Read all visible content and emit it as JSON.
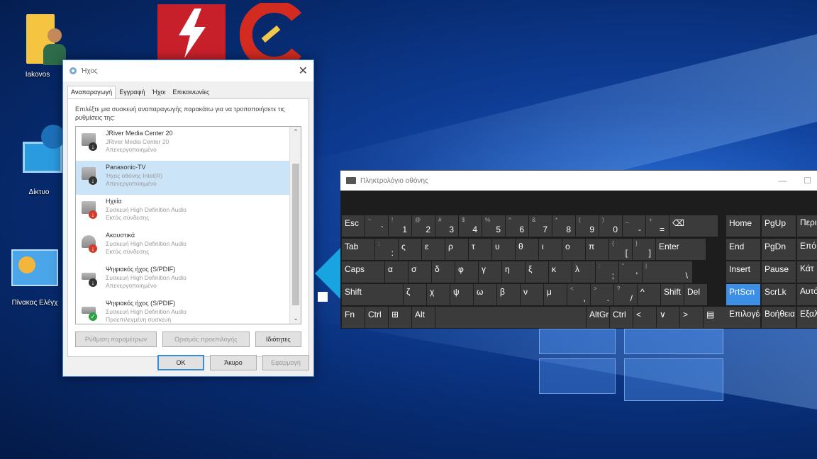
{
  "desktop": {
    "icons": [
      {
        "label": "Iakovos"
      },
      {
        "label": "Δίκτυο"
      },
      {
        "label": "Πίνακας Ελέγχ"
      }
    ]
  },
  "sound_dialog": {
    "title": "Ήχος",
    "tabs": [
      "Αναπαραγωγή",
      "Εγγραφή",
      "Ήχοι",
      "Επικοινωνίες"
    ],
    "description": "Επιλέξτε μια συσκευή αναπαραγωγής παρακάτω για να τροποποιήσετε τις ρυθμίσεις της:",
    "devices": [
      {
        "name": "JRiver Media Center 20",
        "driver": "JRiver Media Center 20",
        "status": "Απενεργοποιημένο"
      },
      {
        "name": "Panasonic-TV",
        "driver": "Ήχος οθόνης Intel(R)",
        "status": "Απενεργοποιημένο"
      },
      {
        "name": "Ηχεία",
        "driver": "Συσκευή High Definition Audio",
        "status": "Εκτός σύνδεσης"
      },
      {
        "name": "Ακουστικά",
        "driver": "Συσκευή High Definition Audio",
        "status": "Εκτός σύνδεσης"
      },
      {
        "name": "Ψηφιακός ήχος (S/PDIF)",
        "driver": "Συσκευή High Definition Audio",
        "status": "Απενεργοποιημένο"
      },
      {
        "name": "Ψηφιακός ήχος (S/PDIF)",
        "driver": "Συσκευή High Definition Audio",
        "status": "Προεπιλεγμένη συσκευή"
      }
    ],
    "buttons": {
      "configure": "Ρύθμιση παραμέτρων",
      "set_default": "Ορισμός προεπιλογής",
      "properties": "Ιδιότητες",
      "ok": "OK",
      "cancel": "Άκυρο",
      "apply": "Εφαρμογή"
    }
  },
  "osk": {
    "title": "Πληκτρολόγιο οθόνης",
    "rows": [
      [
        "Esc",
        "~ `",
        "! 1",
        "@ 2",
        "# 3",
        "$ 4",
        "% 5",
        "^ 6",
        "& 7",
        "* 8",
        "( 9",
        ") 0",
        "_ -",
        "+ =",
        "⌫"
      ],
      [
        "Tab",
        "; :",
        "ς",
        "ε",
        "ρ",
        "τ",
        "υ",
        "θ",
        "ι",
        "ο",
        "π",
        "{ [",
        "} ]",
        "Enter"
      ],
      [
        "Caps",
        "α",
        "σ",
        "δ",
        "φ",
        "γ",
        "η",
        "ξ",
        "κ",
        "λ",
        ": ;",
        "\" '",
        "| \\"
      ],
      [
        "Shift",
        "ζ",
        "χ",
        "ψ",
        "ω",
        "β",
        "ν",
        "μ",
        "< ,",
        "> .",
        "? /",
        "^",
        "Shift",
        "Del"
      ],
      [
        "Fn",
        "Ctrl",
        "⊞",
        "Alt",
        "",
        "AltGr",
        "Ctrl",
        "<",
        "∨",
        ">",
        "▤"
      ]
    ],
    "nav": [
      [
        "Home",
        "PgUp",
        "Περιή"
      ],
      [
        "End",
        "PgDn",
        "Επό"
      ],
      [
        "Insert",
        "Pause",
        "Κάτ"
      ],
      [
        "PrtScn",
        "ScrLk",
        "Αυτόμ"
      ],
      [
        "Επιλογές",
        "Βοήθεια",
        "Εξαλ"
      ]
    ]
  }
}
